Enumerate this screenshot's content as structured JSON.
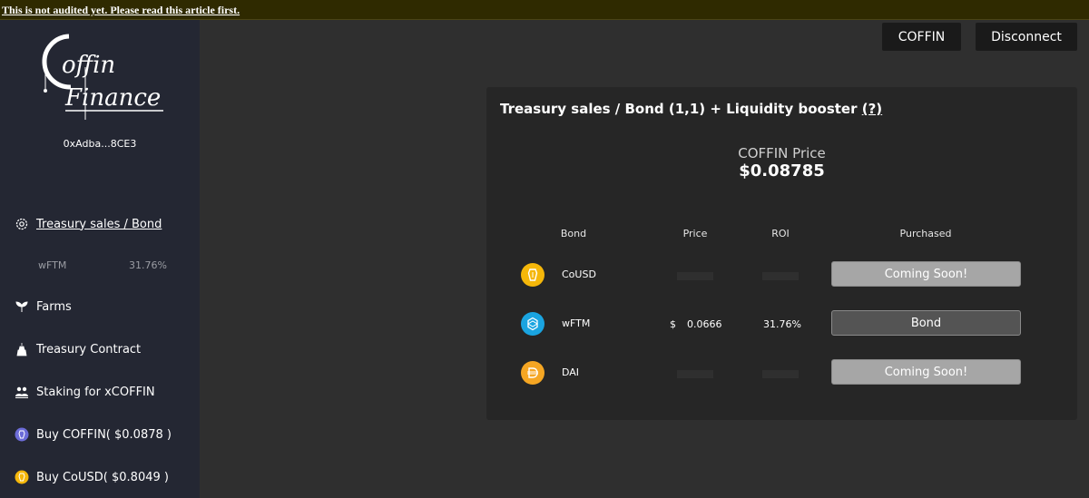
{
  "banner": {
    "text": "This is not audited yet. Please read this article first."
  },
  "sidebar": {
    "logo_text": "Coffin Finance",
    "address": "0xAdba...8CE3",
    "nav": [
      {
        "label": "Treasury sales / Bond",
        "icon": "gear-icon"
      },
      {
        "label": "Farms",
        "icon": "sprout-icon"
      },
      {
        "label": "Treasury Contract",
        "icon": "tower-icon"
      },
      {
        "label": "Staking for xCOFFIN",
        "icon": "people-icon"
      },
      {
        "label": "Buy COFFIN( $0.0878 )",
        "icon": "coffin-token-icon"
      },
      {
        "label": "Buy CoUSD( $0.8049 )",
        "icon": "cousd-token-icon"
      }
    ],
    "sub_items": [
      {
        "label": "wFTM",
        "value": "31.76%"
      }
    ]
  },
  "header": {
    "coffin_button": "COFFIN",
    "disconnect_button": "Disconnect"
  },
  "card": {
    "title": "Treasury sales / Bond (1,1) + Liquidity booster",
    "help": "(?)",
    "price_label": "COFFIN Price",
    "price_value": "$0.08785",
    "columns": [
      "Bond",
      "Price",
      "ROI",
      "Purchased"
    ],
    "rows": [
      {
        "name": "CoUSD",
        "price": "",
        "roi": "",
        "action": "Coming Soon!"
      },
      {
        "name": "wFTM",
        "price_symbol": "$",
        "price": "0.0666",
        "roi": "31.76%",
        "action": "Bond"
      },
      {
        "name": "DAI",
        "price": "",
        "roi": "",
        "action": "Coming Soon!"
      }
    ]
  },
  "colors": {
    "banner_bg": "#2f2a00",
    "sidebar_bg": "#242733",
    "main_bg": "#2f2f2f",
    "card_bg": "#262626",
    "button_soon": "#a6a6a6",
    "button_bond": "#545454",
    "cousd_token": "#f5b70a",
    "wftm_token": "#1aa4e0",
    "dai_token": "#f5a623"
  }
}
